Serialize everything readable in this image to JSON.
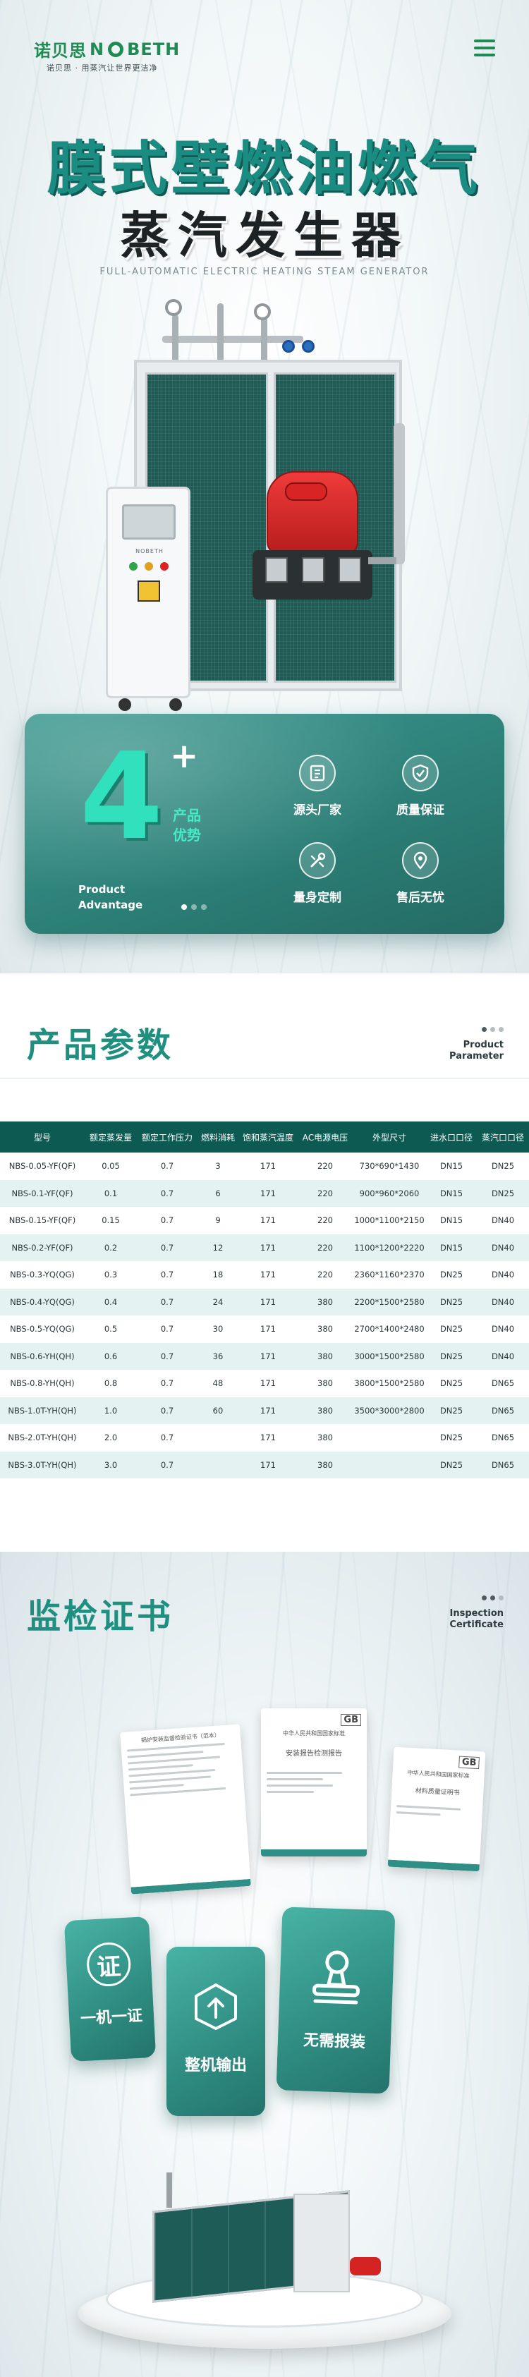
{
  "brand": {
    "cn": "诺贝思",
    "en_prefix": "N",
    "en_suffix": "BETH",
    "tagline": "诺贝思 · 用蒸汽让世界更洁净",
    "accent": "#1f8a54"
  },
  "hero": {
    "title_line1": "膜式壁燃油燃气",
    "title_line2": "蒸汽发生器",
    "subtitle": "FULL-AUTOMATIC ELECTRIC HEATING STEAM GENERATOR",
    "panel_brand": "NOBETH"
  },
  "advantage": {
    "number": "4",
    "plus": "+",
    "cn_line1": "产品",
    "cn_line2": "优势",
    "en_line1": "Product",
    "en_line2": "Advantage",
    "features": [
      {
        "label": "源头厂家",
        "icon": "factory-icon"
      },
      {
        "label": "质量保证",
        "icon": "quality-shield-icon"
      },
      {
        "label": "量身定制",
        "icon": "custom-tools-icon"
      },
      {
        "label": "售后无忧",
        "icon": "service-location-icon"
      }
    ],
    "card_color": "#2c8078"
  },
  "params": {
    "title": "产品参数",
    "en_line1": "Product",
    "en_line2": "Parameter",
    "columns": [
      "型号",
      "额定蒸发量",
      "额定工作压力",
      "燃料消耗",
      "饱和蒸汽温度",
      "AC电源电压",
      "外型尺寸",
      "进水口口径",
      "蒸汽口口径"
    ],
    "rows": [
      [
        "NBS-0.05-YF(QF)",
        "0.05",
        "0.7",
        "3",
        "171",
        "220",
        "730*690*1430",
        "DN15",
        "DN25"
      ],
      [
        "NBS-0.1-YF(QF)",
        "0.1",
        "0.7",
        "6",
        "171",
        "220",
        "900*960*2060",
        "DN15",
        "DN25"
      ],
      [
        "NBS-0.15-YF(QF)",
        "0.15",
        "0.7",
        "9",
        "171",
        "220",
        "1000*1100*2150",
        "DN15",
        "DN40"
      ],
      [
        "NBS-0.2-YF(QF)",
        "0.2",
        "0.7",
        "12",
        "171",
        "220",
        "1100*1200*2220",
        "DN15",
        "DN40"
      ],
      [
        "NBS-0.3-YQ(QG)",
        "0.3",
        "0.7",
        "18",
        "171",
        "220",
        "2360*1160*2370",
        "DN25",
        "DN40"
      ],
      [
        "NBS-0.4-YQ(QG)",
        "0.4",
        "0.7",
        "24",
        "171",
        "380",
        "2200*1500*2580",
        "DN25",
        "DN40"
      ],
      [
        "NBS-0.5-YQ(QG)",
        "0.5",
        "0.7",
        "30",
        "171",
        "380",
        "2700*1400*2480",
        "DN25",
        "DN40"
      ],
      [
        "NBS-0.6-YH(QH)",
        "0.6",
        "0.7",
        "36",
        "171",
        "380",
        "3000*1500*2580",
        "DN25",
        "DN40"
      ],
      [
        "NBS-0.8-YH(QH)",
        "0.8",
        "0.7",
        "48",
        "171",
        "380",
        "3800*1500*2580",
        "DN25",
        "DN65"
      ],
      [
        "NBS-1.0T-YH(QH)",
        "1.0",
        "0.7",
        "60",
        "171",
        "380",
        "3500*3000*2800",
        "DN25",
        "DN65"
      ],
      [
        "NBS-2.0T-YH(QH)",
        "2.0",
        "0.7",
        "",
        "171",
        "380",
        "",
        "DN25",
        "DN65"
      ],
      [
        "NBS-3.0T-YH(QH)",
        "3.0",
        "0.7",
        "",
        "171",
        "380",
        "",
        "DN25",
        "DN65"
      ]
    ],
    "header_color": "#0d5a52",
    "stripe_color": "#e4f3f2"
  },
  "cert": {
    "title": "监检证书",
    "en_line1": "Inspection",
    "en_line2": "Certificate",
    "doc1_header": "锅炉安装监督检验证书（范本）",
    "doc2_header": "中华人民共和国国家标准",
    "doc2_title": "安装报告检测报告",
    "doc3_header": "中华人民共和国国家标准",
    "doc3_title": "材料质量证明书",
    "doc_badge": "GB",
    "cards": [
      {
        "icon_char": "证",
        "label": "一机一证"
      },
      {
        "label": "整机输出",
        "icon": "upload-box-icon"
      },
      {
        "label": "无需报装",
        "icon": "stamp-icon"
      }
    ]
  }
}
